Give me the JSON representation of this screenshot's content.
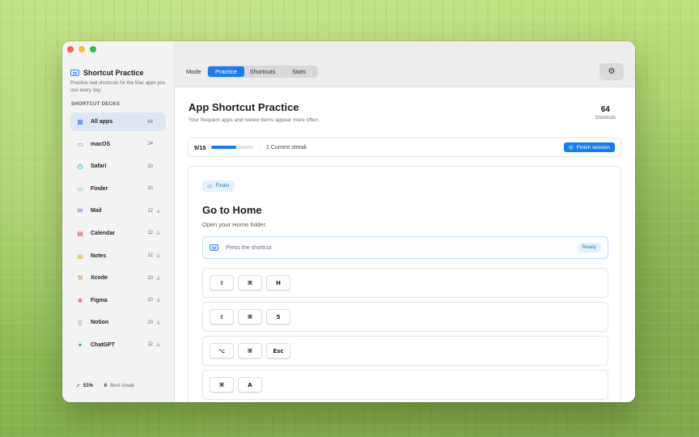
{
  "window": {
    "title": "Shortcut Practice",
    "subtitle": "Practice real shortcuts for the Mac apps you use every day."
  },
  "sidebar": {
    "section_label": "SHORTCUT DECKS",
    "decks": [
      {
        "label": "All apps",
        "count": "64",
        "icon": "grid-icon",
        "locked": false,
        "active": true
      },
      {
        "label": "macOS",
        "count": "24",
        "icon": "display-icon",
        "locked": false,
        "active": false
      },
      {
        "label": "Safari",
        "count": "20",
        "icon": "compass-icon",
        "locked": false,
        "active": false
      },
      {
        "label": "Finder",
        "count": "20",
        "icon": "folder-icon",
        "locked": false,
        "active": false
      },
      {
        "label": "Mail",
        "count": "12",
        "icon": "mail-icon",
        "locked": true,
        "active": false
      },
      {
        "label": "Calendar",
        "count": "12",
        "icon": "calendar-icon",
        "locked": true,
        "active": false
      },
      {
        "label": "Notes",
        "count": "12",
        "icon": "notes-icon",
        "locked": true,
        "active": false
      },
      {
        "label": "Xcode",
        "count": "20",
        "icon": "hammer-icon",
        "locked": true,
        "active": false
      },
      {
        "label": "Figma",
        "count": "20",
        "icon": "figma-icon",
        "locked": true,
        "active": false
      },
      {
        "label": "Notion",
        "count": "20",
        "icon": "document-icon",
        "locked": true,
        "active": false
      },
      {
        "label": "ChatGPT",
        "count": "12",
        "icon": "sparkle-icon",
        "locked": true,
        "active": false
      }
    ],
    "footer": {
      "accuracy": "51%",
      "best_streak": "6",
      "best_streak_label": "Best streak"
    }
  },
  "toolbar": {
    "mode_label": "Mode",
    "modes": [
      "Practice",
      "Shortcuts",
      "Stats"
    ],
    "active_mode": "Practice"
  },
  "main": {
    "title": "App Shortcut Practice",
    "subtitle": "Your frequent apps and review items appear more often.",
    "total_count": "64",
    "total_label": "Shortcuts",
    "progress": {
      "text": "9/15",
      "fraction": 0.6,
      "streak": "1 Current streak",
      "finish_label": "Finish session"
    },
    "question": {
      "app": "Finder",
      "title": "Go to Home",
      "description": "Open your Home folder.",
      "input_placeholder": "Press the shortcut",
      "status": "Ready",
      "options": [
        [
          "⇧",
          "⌘",
          "H"
        ],
        [
          "⇧",
          "⌘",
          "5"
        ],
        [
          "⌥",
          "⌘",
          "Esc"
        ],
        [
          "⌘",
          "A"
        ]
      ]
    }
  },
  "colors": {
    "accent": "#1a7cf3",
    "sidebar_active": "#dfe6f5",
    "chip_bg": "#e3f1fb",
    "chip_text": "#2a7ab5"
  }
}
